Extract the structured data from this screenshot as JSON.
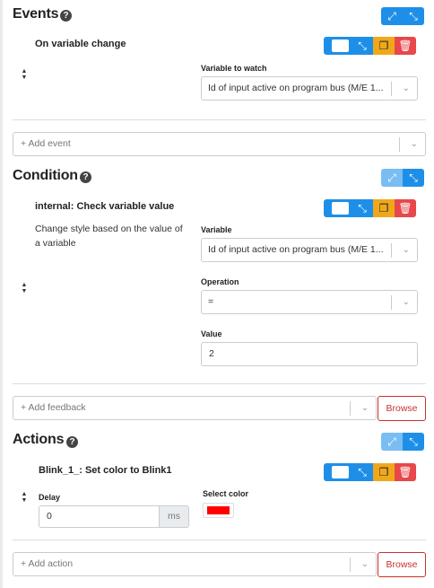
{
  "events": {
    "title": "Events",
    "help_icon": "question-circle-icon",
    "expand_icon": "expand-arrows-icon",
    "collapse_icon": "compress-arrows-icon",
    "item": {
      "title": "On variable change",
      "field_label": "Variable to watch",
      "field_value": "Id of input active on program bus (M/E 1..."
    },
    "add_placeholder": "+ Add event"
  },
  "condition": {
    "title": "Condition",
    "item": {
      "title": "internal: Check variable value",
      "description": "Change style based on the value of a variable",
      "variable_label": "Variable",
      "variable_value": "Id of input active on program bus (M/E 1...",
      "operation_label": "Operation",
      "operation_value": "=",
      "value_label": "Value",
      "value_value": "2"
    },
    "add_placeholder": "+ Add feedback",
    "browse_label": "Browse"
  },
  "actions": {
    "title": "Actions",
    "item": {
      "title": "Blink_1_: Set color to Blink1",
      "delay_label": "Delay",
      "delay_value": "0",
      "delay_unit": "ms",
      "color_label": "Select color",
      "color_value": "#ff0000"
    },
    "add_placeholder": "+ Add action",
    "browse_label": "Browse"
  },
  "glyphs": {
    "expand": "⤢",
    "collapse": "⤡",
    "duplicate": "❐",
    "delete": "🗑",
    "chevron": "⌄",
    "sort_up": "▲",
    "sort_down": "▼",
    "help": "?"
  },
  "colors": {
    "primary": "#1e8fe8",
    "primary_light": "#79bdf2",
    "warning": "#f0a81b",
    "danger": "#e8474b",
    "outline_danger": "#c9302c"
  }
}
